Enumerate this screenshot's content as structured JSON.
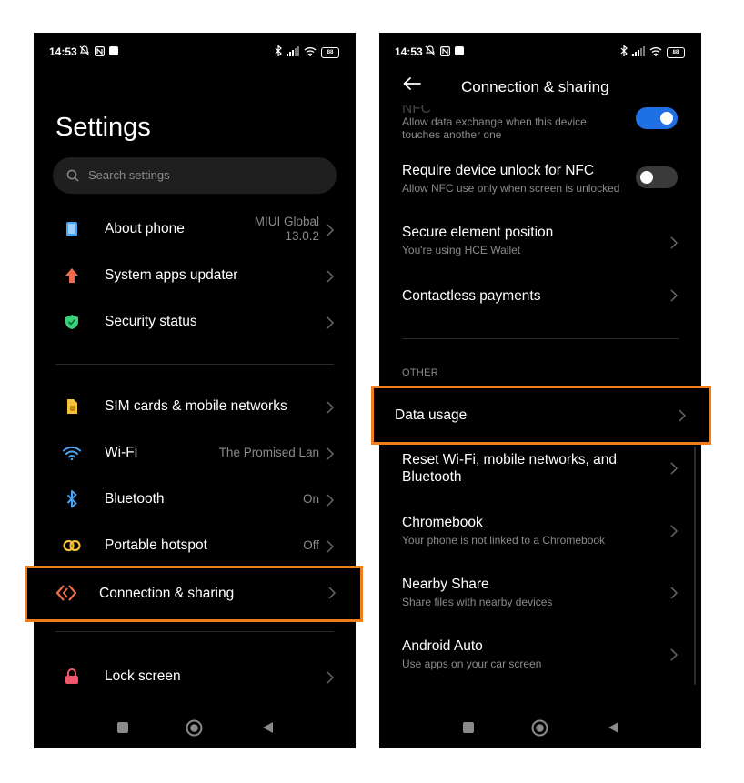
{
  "colors": {
    "accent_orange": "#f07d1c",
    "toggle_on": "#1f6fe5",
    "toggle_off": "#3a3a3a",
    "muted_text": "#8a8a8a"
  },
  "status_bar": {
    "time": "14:53",
    "battery": "88"
  },
  "left": {
    "title": "Settings",
    "search_placeholder": "Search settings",
    "group1": [
      {
        "label": "About phone",
        "value_line1": "MIUI Global",
        "value_line2": "13.0.2",
        "icon": "phone-info-icon",
        "color": "#4aa3f5"
      },
      {
        "label": "System apps updater",
        "icon": "arrow-up-icon",
        "color": "#f06a4f"
      },
      {
        "label": "Security status",
        "icon": "shield-check-icon",
        "color": "#3ccf7a"
      }
    ],
    "group2": [
      {
        "label": "SIM cards & mobile networks",
        "icon": "sim-card-icon",
        "color": "#f7c23b"
      },
      {
        "label": "Wi-Fi",
        "value": "The Promised Lan",
        "icon": "wifi-icon",
        "color": "#4aa3f5"
      },
      {
        "label": "Bluetooth",
        "value": "On",
        "icon": "bluetooth-icon",
        "color": "#4aa3f5"
      },
      {
        "label": "Portable hotspot",
        "value": "Off",
        "icon": "hotspot-icon",
        "color": "#f7c23b"
      },
      {
        "label": "Connection & sharing",
        "icon": "connection-sharing-icon",
        "color": "#f06a4f"
      }
    ],
    "group3": [
      {
        "label": "Lock screen",
        "icon": "lock-icon",
        "color": "#f0576b"
      }
    ]
  },
  "right": {
    "header_title": "Connection & sharing",
    "items": [
      {
        "title": "NFC",
        "subtitle_line1": "Allow data exchange when this device",
        "subtitle_line2": "touches another one",
        "toggle": true
      },
      {
        "title": "Require device unlock for NFC",
        "subtitle": "Allow NFC use only when screen is unlocked",
        "toggle": false
      },
      {
        "title": "Secure element position",
        "subtitle": "You're using HCE Wallet"
      },
      {
        "title": "Contactless payments"
      }
    ],
    "section_other": "OTHER",
    "other_items": [
      {
        "title": "Data usage"
      },
      {
        "title_line1": "Reset Wi-Fi, mobile networks, and",
        "title_line2": "Bluetooth"
      },
      {
        "title": "Chromebook",
        "subtitle": "Your phone is not linked to a Chromebook"
      },
      {
        "title": "Nearby Share",
        "subtitle": "Share files with nearby devices"
      },
      {
        "title": "Android Auto",
        "subtitle": "Use apps on your car screen"
      }
    ]
  }
}
